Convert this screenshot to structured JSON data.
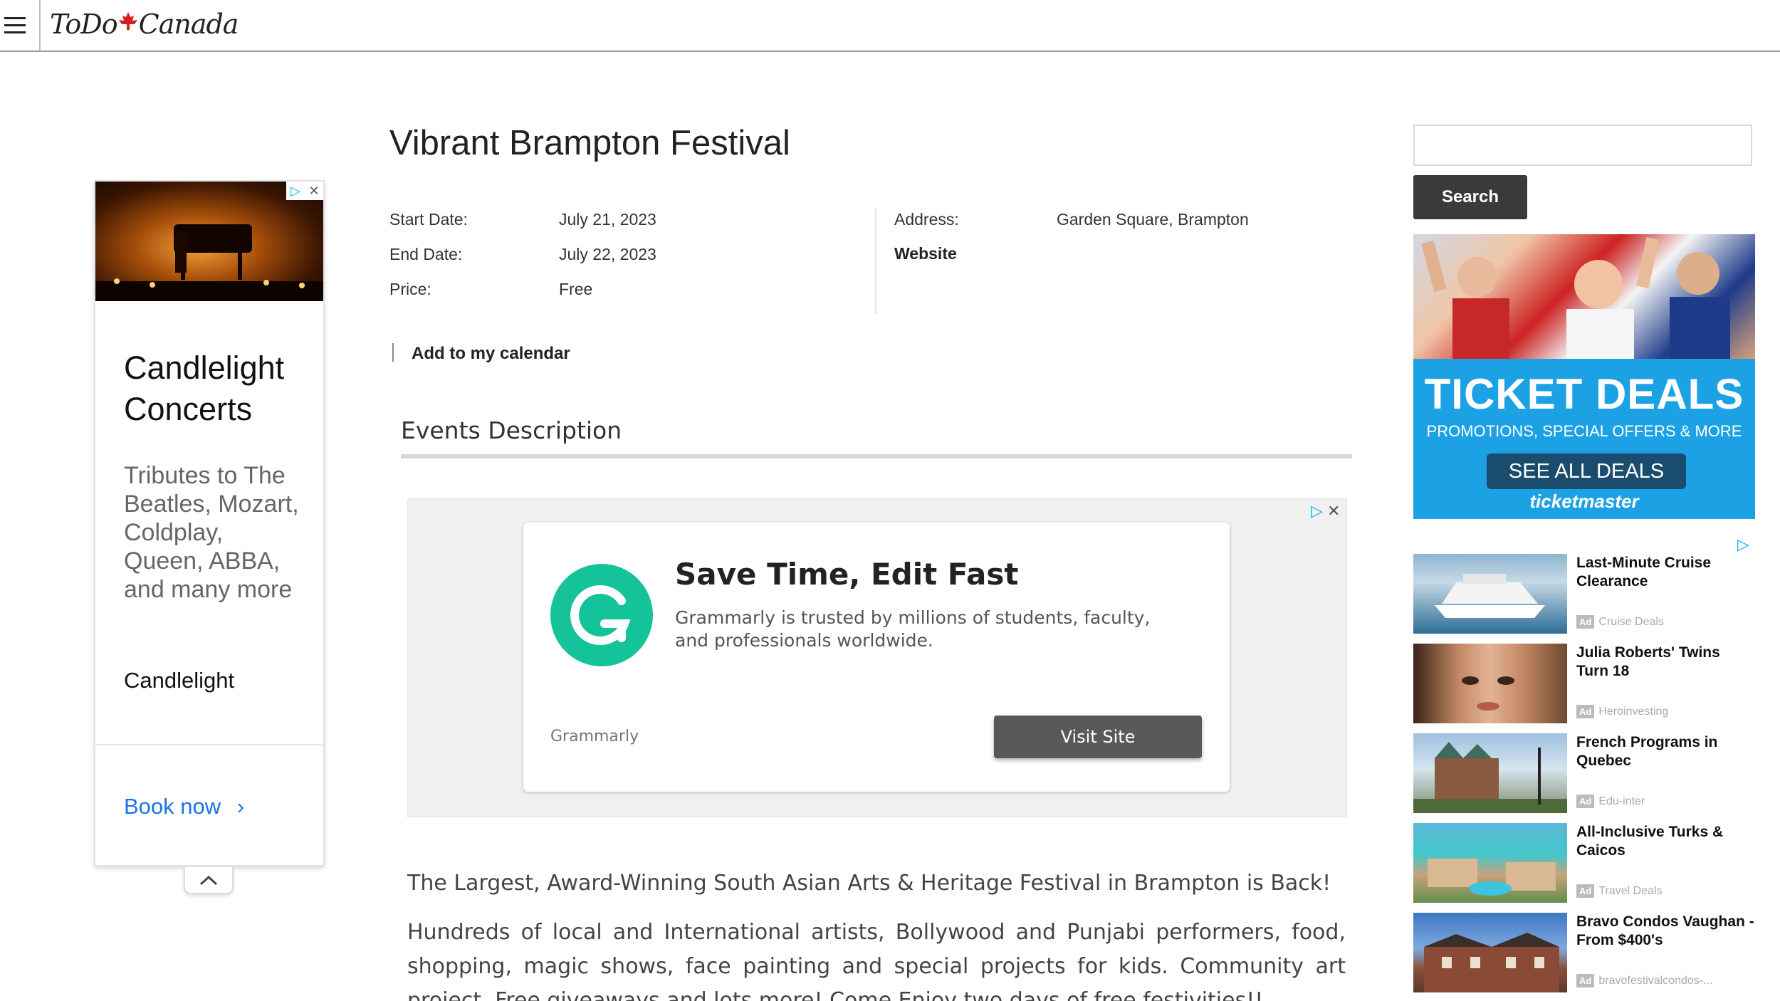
{
  "header": {
    "logo_text": "ToDo Canada"
  },
  "left_ad": {
    "title": "Candlelight Concerts",
    "description": "Tributes to The Beatles, Mozart, Coldplay, Queen, ABBA, and many more",
    "brand": "Candlelight",
    "cta": "Book now",
    "cta_color": "#1a73e8"
  },
  "event": {
    "title": "Vibrant Brampton Festival",
    "start_label": "Start Date:",
    "start_value": "July 21, 2023",
    "end_label": "End Date:",
    "end_value": "July 22, 2023",
    "price_label": "Price:",
    "price_value": "Free",
    "address_label": "Address:",
    "address_value": "Garden Square, Brampton",
    "website_label": "Website",
    "calendar_label": "Add to my calendar",
    "description_heading": "Events Description",
    "paragraph_1": "The Largest, Award-Winning South Asian Arts & Heritage Festival in Brampton is Back!",
    "paragraph_2": "Hundreds of local and International artists, Bollywood and Punjabi performers, food, shopping, magic shows, face painting and special projects for kids. Community art project, Free giveaways and lots more! Come Enjoy two days of free festivities!!"
  },
  "grammarly_ad": {
    "title": "Save Time, Edit Fast",
    "description": "Grammarly is trusted by millions of students, faculty, and professionals worldwide.",
    "brand": "Grammarly",
    "cta": "Visit Site",
    "logo_color": "#15c39a"
  },
  "sidebar": {
    "search_placeholder": "",
    "search_button": "Search",
    "ticket_ad": {
      "headline": "TICKET DEALS",
      "subline": "PROMOTIONS, SPECIAL OFFERS & MORE",
      "cta": "SEE ALL DEALS",
      "brand": "ticketmaster",
      "bg_color": "#1da1e5"
    },
    "sponsored": [
      {
        "title": "Last-Minute Cruise Clearance",
        "source": "Cruise Deals"
      },
      {
        "title": "Julia Roberts' Twins Turn 18",
        "source": "Heroinvesting"
      },
      {
        "title": "French Programs in Quebec",
        "source": "Edu-inter"
      },
      {
        "title": "All-Inclusive Turks & Caicos",
        "source": "Travel Deals"
      },
      {
        "title": "Bravo Condos Vaughan - From $400's",
        "source": "bravofestivalcondos-..."
      }
    ],
    "ad_badge": "Ad"
  }
}
